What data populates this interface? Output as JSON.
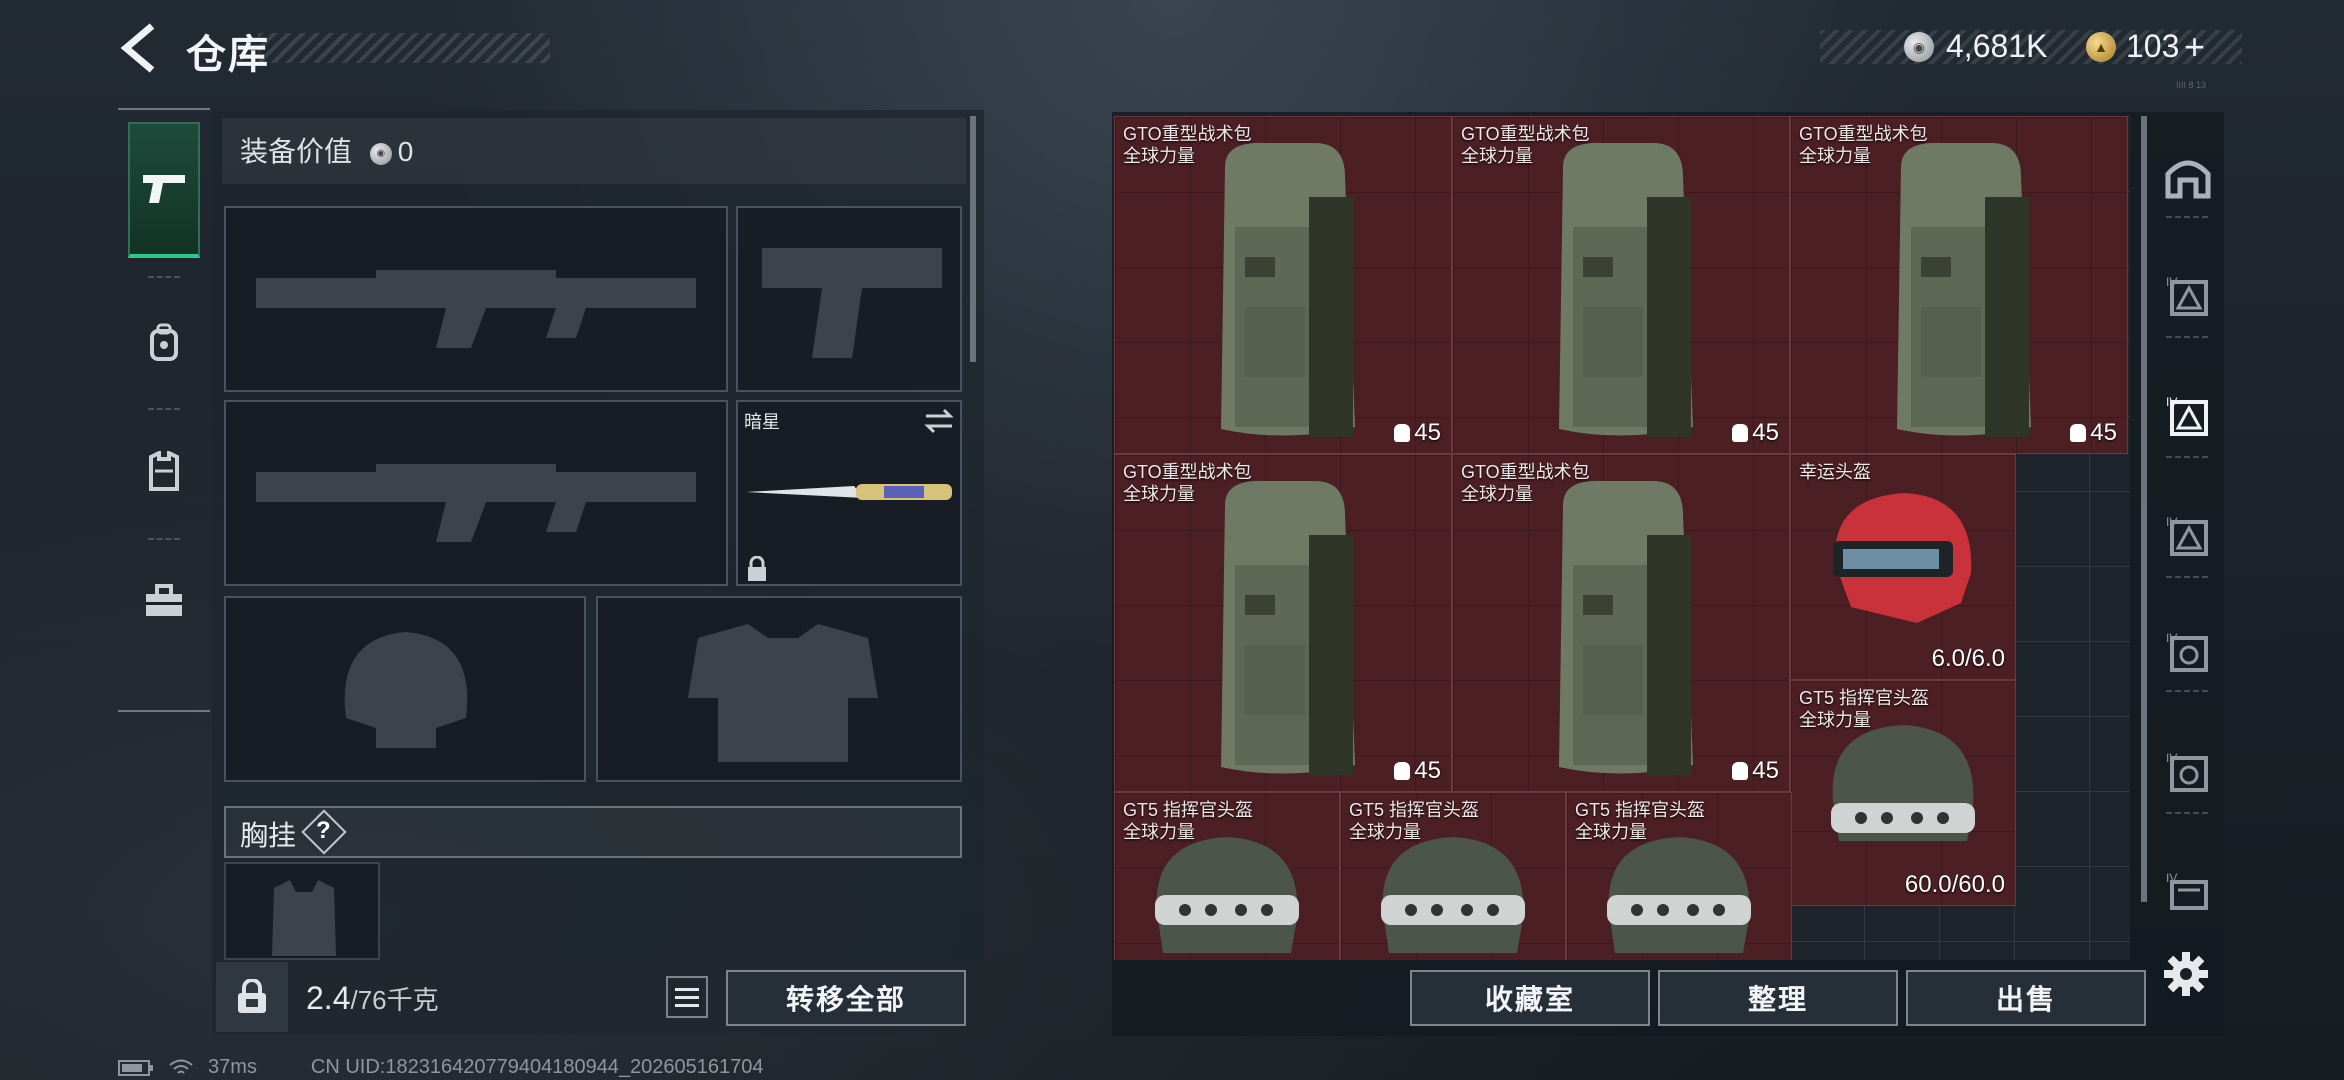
{
  "header": {
    "title": "仓库",
    "silver_amount": "4,681K",
    "gold_amount": "103",
    "gold_plus": "+",
    "corner_tag": "IIII 8 13"
  },
  "equipment": {
    "value_label": "装备价值",
    "value_amount": "0",
    "melee_name": "暗星",
    "chest_label": "胸挂",
    "chest_help": "?",
    "weight_current": "2.4",
    "weight_max": "/76千克",
    "transfer_all_label": "转移全部"
  },
  "storage": {
    "items": [
      {
        "name1": "GTO重型战术包",
        "name2": "全球力量",
        "count": "45"
      },
      {
        "name1": "GTO重型战术包",
        "name2": "全球力量",
        "count": "45"
      },
      {
        "name1": "GTO重型战术包",
        "name2": "全球力量",
        "count": "45"
      },
      {
        "name1": "GTO重型战术包",
        "name2": "全球力量",
        "count": "45"
      },
      {
        "name1": "GTO重型战术包",
        "name2": "全球力量",
        "count": "45"
      },
      {
        "name1": "幸运头盔",
        "name2": "",
        "count": "6.0/6.0"
      },
      {
        "name1": "GT5 指挥官头盔",
        "name2": "全球力量",
        "count": "60.0/60.0"
      },
      {
        "name1": "GT5 指挥官头盔",
        "name2": "全球力量",
        "count": ""
      },
      {
        "name1": "GT5 指挥官头盔",
        "name2": "全球力量",
        "count": ""
      },
      {
        "name1": "GT5 指挥官头盔",
        "name2": "全球力量",
        "count": ""
      }
    ],
    "collection_label": "收藏室",
    "organize_label": "整理",
    "sell_label": "出售"
  },
  "status_bar": {
    "ping": "37ms",
    "uid": "CN UID:182316420779404180944_202605161704"
  },
  "colors": {
    "item_bg": "#4b1f24",
    "active_tab": "#29c98a"
  }
}
